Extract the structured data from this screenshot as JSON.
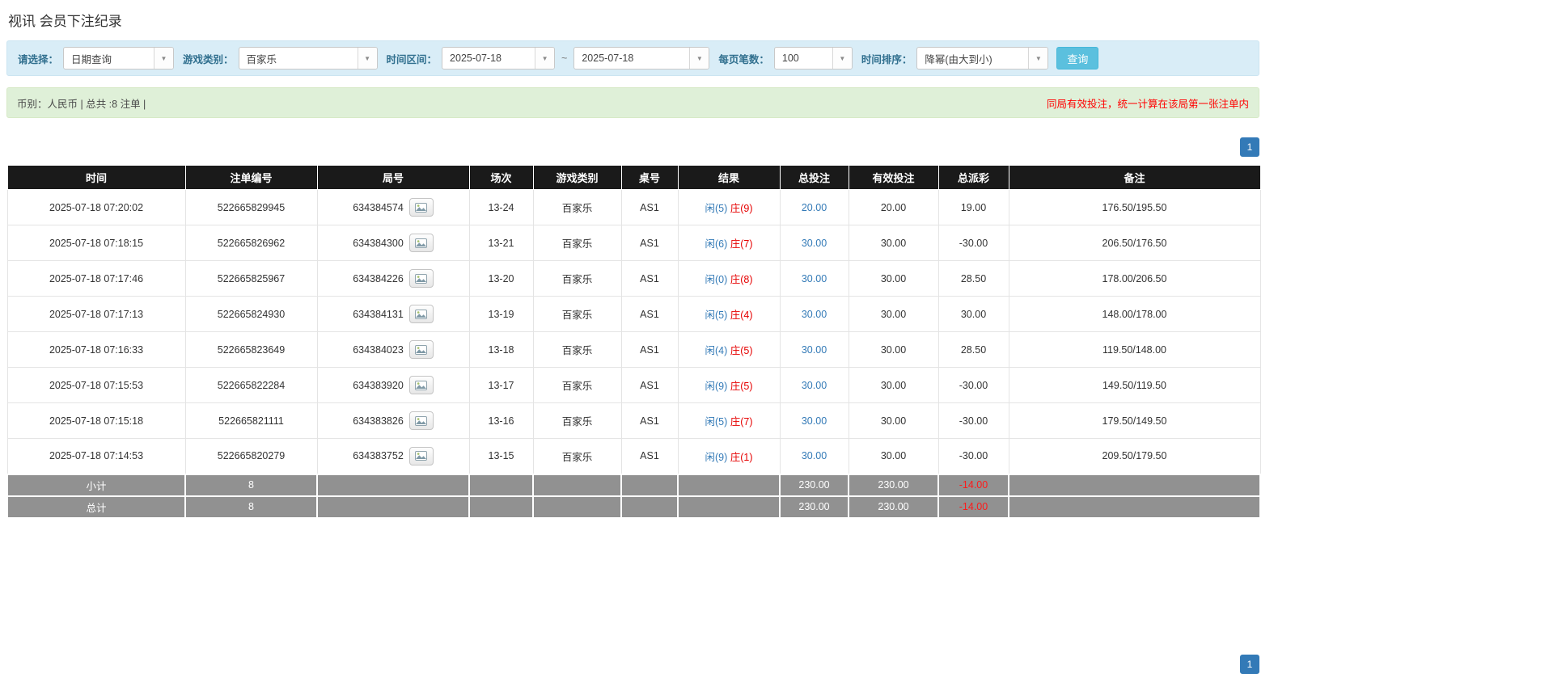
{
  "page": {
    "title": "视讯 会员下注纪录"
  },
  "filters": {
    "select_label": "请选择：",
    "select_value": "日期查询",
    "game_label": "游戏类别：",
    "game_value": "百家乐",
    "range_label": "时间区间：",
    "date_from": "2025-07-18",
    "range_separator": "~",
    "date_to": "2025-07-18",
    "page_size_label": "每页笔数：",
    "page_size_value": "100",
    "sort_label": "时间排序：",
    "sort_value": "降幂(由大到小)",
    "search_button_label": "查询"
  },
  "summary": {
    "left": "币别：人民币 | 总共 :8 注单 |",
    "right": "同局有效投注，统一计算在该局第一张注单内"
  },
  "pagination": {
    "page": "1"
  },
  "table": {
    "headers": [
      "时间",
      "注单编号",
      "局号",
      "场次",
      "游戏类别",
      "桌号",
      "结果",
      "总投注",
      "有效投注",
      "总派彩",
      "备注"
    ],
    "rows": [
      {
        "time": "2025-07-18 07:20:02",
        "bet_id": "522665829945",
        "round_id": "634384574",
        "session": "13-24",
        "game": "百家乐",
        "table_no": "AS1",
        "result_player": "闲(5)",
        "result_banker": "庄(9)",
        "total_bet": "20.00",
        "valid_bet": "20.00",
        "payout": "19.00",
        "remark": "176.50/195.50"
      },
      {
        "time": "2025-07-18 07:18:15",
        "bet_id": "522665826962",
        "round_id": "634384300",
        "session": "13-21",
        "game": "百家乐",
        "table_no": "AS1",
        "result_player": "闲(6)",
        "result_banker": "庄(7)",
        "total_bet": "30.00",
        "valid_bet": "30.00",
        "payout": "-30.00",
        "remark": "206.50/176.50"
      },
      {
        "time": "2025-07-18 07:17:46",
        "bet_id": "522665825967",
        "round_id": "634384226",
        "session": "13-20",
        "game": "百家乐",
        "table_no": "AS1",
        "result_player": "闲(0)",
        "result_banker": "庄(8)",
        "total_bet": "30.00",
        "valid_bet": "30.00",
        "payout": "28.50",
        "remark": "178.00/206.50"
      },
      {
        "time": "2025-07-18 07:17:13",
        "bet_id": "522665824930",
        "round_id": "634384131",
        "session": "13-19",
        "game": "百家乐",
        "table_no": "AS1",
        "result_player": "闲(5)",
        "result_banker": "庄(4)",
        "total_bet": "30.00",
        "valid_bet": "30.00",
        "payout": "30.00",
        "remark": "148.00/178.00"
      },
      {
        "time": "2025-07-18 07:16:33",
        "bet_id": "522665823649",
        "round_id": "634384023",
        "session": "13-18",
        "game": "百家乐",
        "table_no": "AS1",
        "result_player": "闲(4)",
        "result_banker": "庄(5)",
        "total_bet": "30.00",
        "valid_bet": "30.00",
        "payout": "28.50",
        "remark": "119.50/148.00"
      },
      {
        "time": "2025-07-18 07:15:53",
        "bet_id": "522665822284",
        "round_id": "634383920",
        "session": "13-17",
        "game": "百家乐",
        "table_no": "AS1",
        "result_player": "闲(9)",
        "result_banker": "庄(5)",
        "total_bet": "30.00",
        "valid_bet": "30.00",
        "payout": "-30.00",
        "remark": "149.50/119.50"
      },
      {
        "time": "2025-07-18 07:15:18",
        "bet_id": "522665821111",
        "round_id": "634383826",
        "session": "13-16",
        "game": "百家乐",
        "table_no": "AS1",
        "result_player": "闲(5)",
        "result_banker": "庄(7)",
        "total_bet": "30.00",
        "valid_bet": "30.00",
        "payout": "-30.00",
        "remark": "179.50/149.50"
      },
      {
        "time": "2025-07-18 07:14:53",
        "bet_id": "522665820279",
        "round_id": "634383752",
        "session": "13-15",
        "game": "百家乐",
        "table_no": "AS1",
        "result_player": "闲(9)",
        "result_banker": "庄(1)",
        "total_bet": "30.00",
        "valid_bet": "30.00",
        "payout": "-30.00",
        "remark": "209.50/179.50"
      }
    ],
    "subtotal": {
      "label": "小计",
      "count": "8",
      "total_bet": "230.00",
      "valid_bet": "230.00",
      "payout": "-14.00",
      "remark": ""
    },
    "total": {
      "label": "总计",
      "count": "8",
      "total_bet": "230.00",
      "valid_bet": "230.00",
      "payout": "-14.00",
      "remark": ""
    }
  }
}
